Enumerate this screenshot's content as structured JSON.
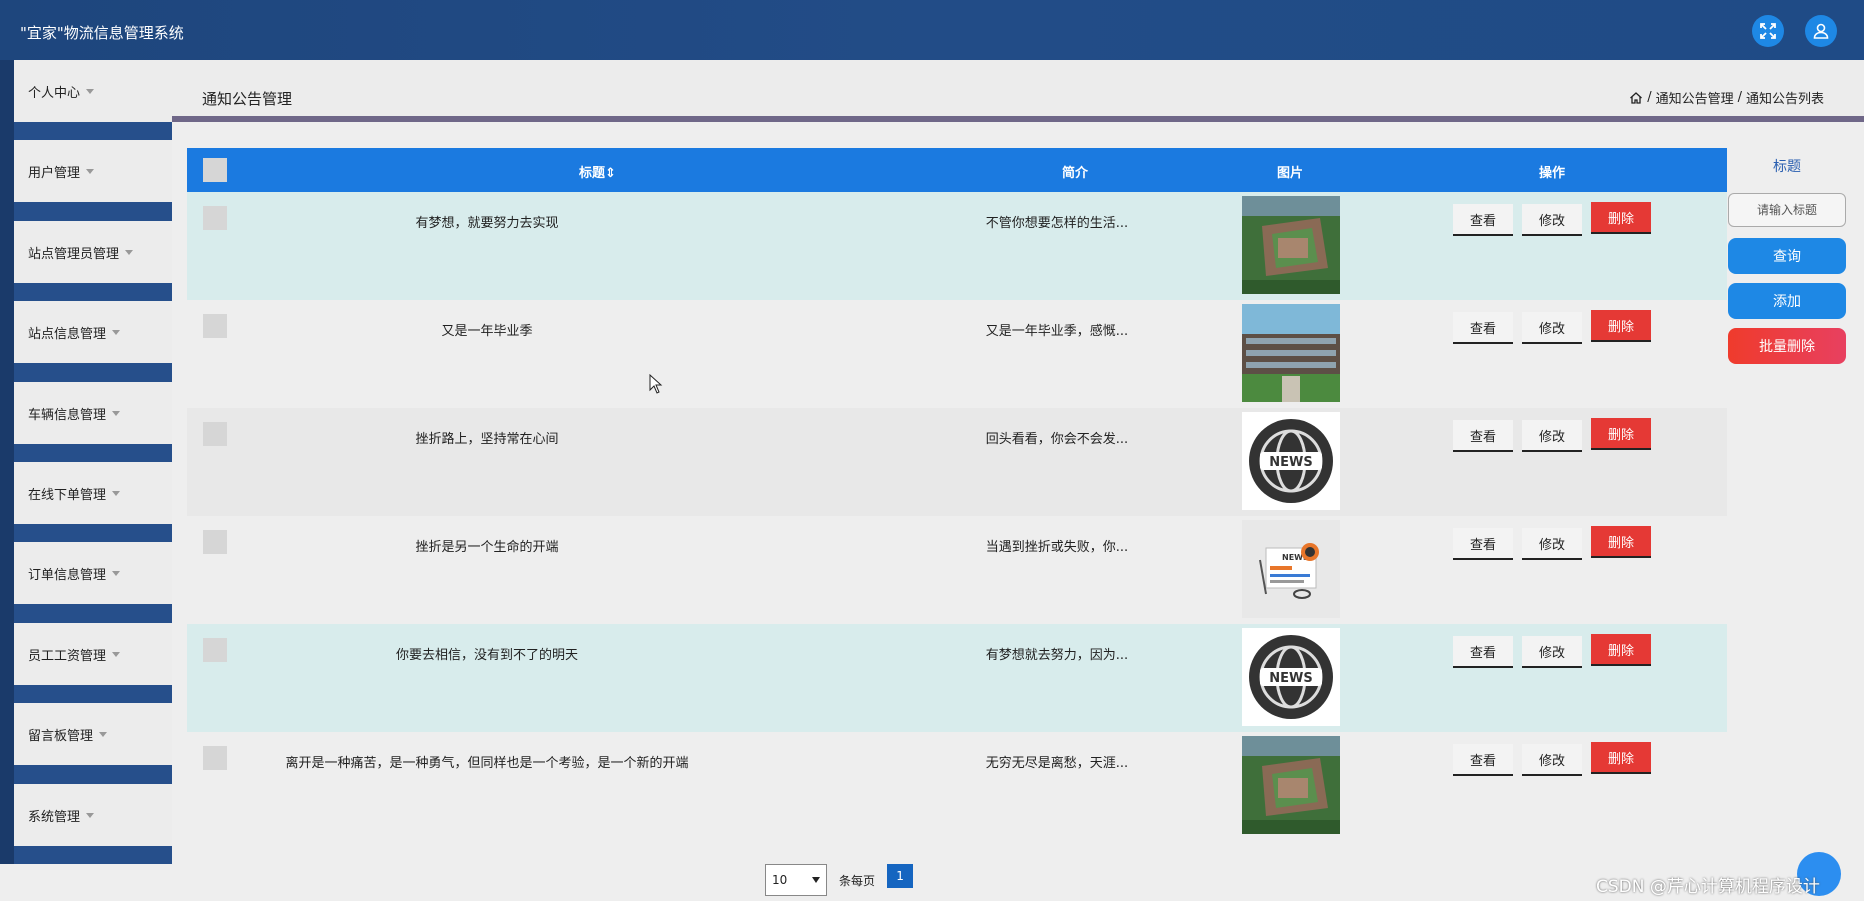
{
  "header": {
    "title": "\"宜家\"物流信息管理系统",
    "fullscreen_icon": "fullscreen-icon",
    "user_icon": "user-icon"
  },
  "sidebar": {
    "items": [
      {
        "label": "个人中心"
      },
      {
        "label": "用户管理"
      },
      {
        "label": "站点管理员管理"
      },
      {
        "label": "站点信息管理"
      },
      {
        "label": "车辆信息管理"
      },
      {
        "label": "在线下单管理"
      },
      {
        "label": "订单信息管理"
      },
      {
        "label": "员工工资管理"
      },
      {
        "label": "留言板管理"
      },
      {
        "label": "系统管理"
      }
    ]
  },
  "page": {
    "title": "通知公告管理",
    "breadcrumb": {
      "home_icon": "home-icon",
      "sep": "/",
      "level1": "通知公告管理",
      "level2": "通知公告列表"
    }
  },
  "table": {
    "headers": {
      "title": "标题",
      "sort_icon": "sort-icon",
      "intro": "简介",
      "picture": "图片",
      "actions": "操作"
    },
    "view_label": "查看",
    "edit_label": "修改",
    "delete_label": "删除",
    "rows": [
      {
        "title": "有梦想，就要努力去实现",
        "intro": "不管你想要怎样的生活...",
        "image": "campus-aerial"
      },
      {
        "title": "又是一年毕业季",
        "intro": "又是一年毕业季，感慨...",
        "image": "campus-building"
      },
      {
        "title": "挫折路上，坚持常在心间",
        "intro": "回头看看，你会不会发...",
        "image": "news-globe"
      },
      {
        "title": "挫折是另一个生命的开端",
        "intro": "当遇到挫折或失败，你...",
        "image": "news-paper"
      },
      {
        "title": "你要去相信，没有到不了的明天",
        "intro": "有梦想就去努力，因为...",
        "image": "news-globe"
      },
      {
        "title": "离开是一种痛苦，是一种勇气，但同样也是一个考验，是一个新的开端",
        "intro": "无穷无尽是离愁，天涯...",
        "image": "campus-aerial"
      }
    ]
  },
  "pager": {
    "page_size": "10",
    "per_page_label": "条每页",
    "current_page": "1"
  },
  "search": {
    "label": "标题",
    "placeholder": "请输入标题",
    "query_label": "查询",
    "add_label": "添加",
    "batch_delete_label": "批量删除"
  },
  "watermark": "CSDN @芹心计算机程序设计"
}
